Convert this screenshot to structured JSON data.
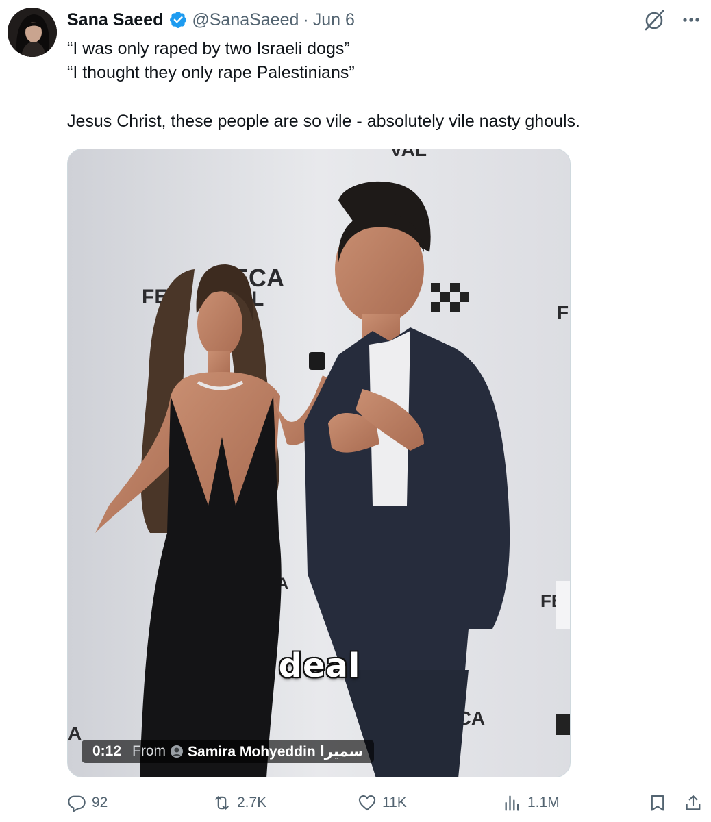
{
  "author": {
    "display_name": "Sana Saeed",
    "handle": "@SanaSaeed",
    "separator": "·",
    "date": "Jun 6",
    "verified_color": "#1d9bf0"
  },
  "tweet": {
    "lines": [
      "“I was only raped by two Israeli dogs”",
      "“I thought they only rape Palestinians”",
      "Jesus Christ, these people are so vile - absolutely vile nasty ghouls."
    ]
  },
  "media": {
    "caption": "deal",
    "timestamp": "0:12",
    "from_label": "From",
    "source_name": "Samira Mohyeddin سميرا",
    "backdrop_texts": [
      "ECA",
      "FE",
      "L",
      "F",
      "FE",
      "ECA",
      "L",
      "A",
      "A",
      "VAL"
    ]
  },
  "actions": {
    "replies": "92",
    "retweets": "2.7K",
    "likes": "11K",
    "views": "1.1M"
  },
  "icons": {
    "top": [
      "grok-icon",
      "more-icon"
    ],
    "bar": [
      "reply-icon",
      "retweet-icon",
      "like-icon",
      "views-icon",
      "bookmark-icon",
      "share-icon"
    ]
  },
  "colors": {
    "text": "#0f1419",
    "secondary": "#536471",
    "border": "#cfd9de"
  }
}
